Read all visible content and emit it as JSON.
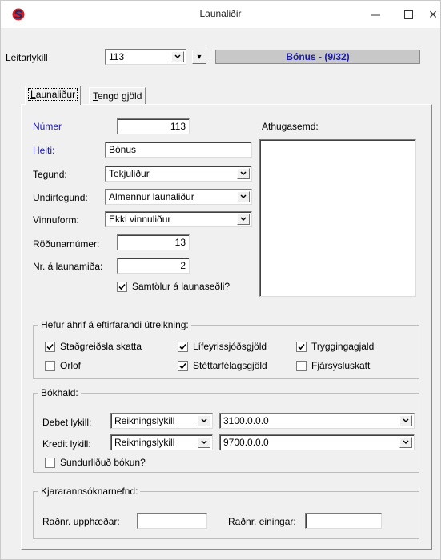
{
  "window": {
    "title": "Launaliðir",
    "icon": "app-logo-icon",
    "controls": [
      "minimize-icon",
      "maximize-icon",
      "close-icon"
    ],
    "close_glyph": "×"
  },
  "search": {
    "label": "Leitarlykill",
    "value": "113",
    "nav_glyph": "▾",
    "status_text": "Bónus  -   (9/32)"
  },
  "tabs": [
    {
      "label_underlined": "L",
      "label_rest": "aunaliður",
      "active": true
    },
    {
      "label_underlined": "T",
      "label_rest": "engd gjöld",
      "active": false
    }
  ],
  "form": {
    "numer_label": "Númer",
    "numer_value": "113",
    "heiti_label": "Heiti:",
    "heiti_value": "Bónus",
    "tegund_label": "Tegund:",
    "tegund_value": "Tekjuliður",
    "undirtegund_label": "Undirtegund:",
    "undirtegund_value": "Almennur launaliður",
    "vinnuform_label": "Vinnuform:",
    "vinnuform_value": "Ekki vinnuliður",
    "rodunarnumer_label": "Röðunarnúmer:",
    "rodunarnumer_value": "13",
    "nr_launamida_label": "Nr. á launamiða:",
    "nr_launamida_value": "2",
    "samtolur_label": "Samtölur á launaseðli?",
    "samtolur_checked": true,
    "athugasemd_label": "Athugasemd:",
    "athugasemd_value": ""
  },
  "effects": {
    "title": "Hefur áhrif á eftirfarandi útreikning:",
    "items": [
      {
        "label": "Staðgreiðsla skatta",
        "checked": true
      },
      {
        "label": "Lífeyrissjóðsgjöld",
        "checked": true
      },
      {
        "label": "Tryggingagjald",
        "checked": true
      },
      {
        "label": "Orlof",
        "checked": false
      },
      {
        "label": "Stéttarfélagsgjöld",
        "checked": true
      },
      {
        "label": "Fjársýsluskatt",
        "checked": false
      }
    ]
  },
  "bokhald": {
    "title": "Bókhald:",
    "debet_label": "Debet lykill:",
    "debet_type": "Reikningslykill",
    "debet_account": "3100.0.0.0",
    "kredit_label": "Kredit lykill:",
    "kredit_type": "Reikningslykill",
    "kredit_account": "9700.0.0.0",
    "sundurlidud_label": "Sundurliðuð bókun?",
    "sundurlidud_checked": false
  },
  "kjara": {
    "title": "Kjararannsóknarnefnd:",
    "upphaedar_label": "Raðnr. upphæðar:",
    "upphaedar_value": "",
    "eininga_label": "Raðnr. einingar:",
    "eininga_value": ""
  },
  "colors": {
    "accent_blue": "#1a1aa6",
    "logo_red": "#d0202a",
    "logo_navy": "#1c2f6b"
  }
}
